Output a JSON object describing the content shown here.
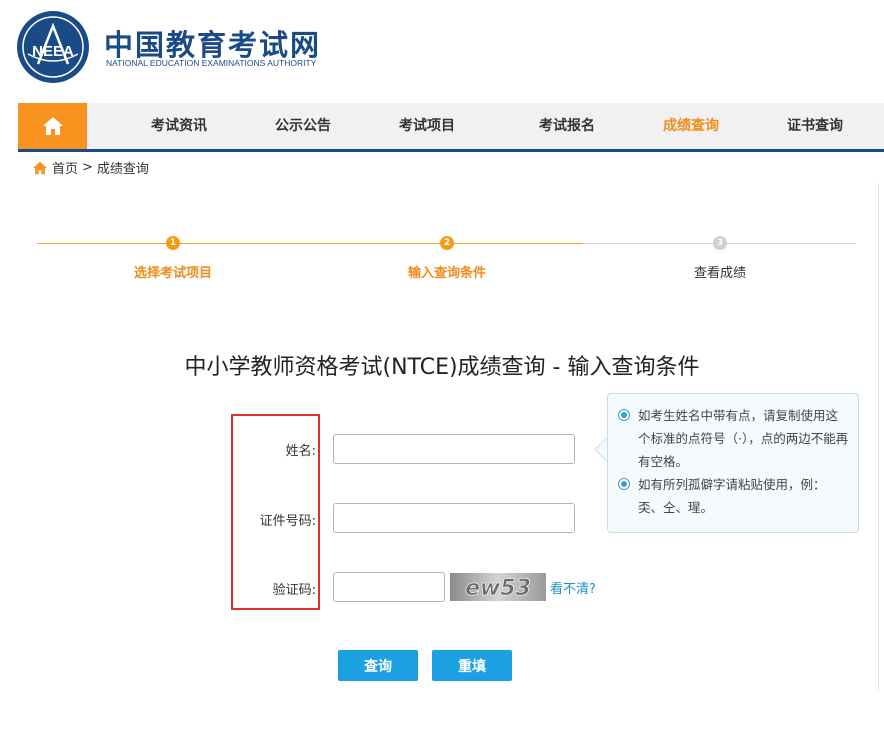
{
  "header": {
    "site_title": "中国教育考试网",
    "site_subtitle": "NATIONAL EDUCATION EXAMINATIONS AUTHORITY",
    "logo_text": "NEEA"
  },
  "nav": {
    "items": [
      "考试资讯",
      "公示公告",
      "考试项目",
      "考试报名",
      "成绩查询",
      "证书查询"
    ],
    "active": "成绩查询",
    "home_icon": "home-icon",
    "bg_color": "#f1f1f1",
    "home_color": "#f7931e",
    "accent_line_color": "#1b4b86"
  },
  "breadcrumb": {
    "home": "首页",
    "separator": ">",
    "current": "成绩查询"
  },
  "steps": [
    {
      "num": "1",
      "label": "选择考试项目",
      "state": "done"
    },
    {
      "num": "2",
      "label": "输入查询条件",
      "state": "active"
    },
    {
      "num": "3",
      "label": "查看成绩",
      "state": "pending"
    }
  ],
  "form": {
    "title": "中小学教师资格考试(NTCE)成绩查询 - 输入查询条件",
    "name_label": "姓名:",
    "name_value": "",
    "id_label": "证件号码:",
    "id_value": "",
    "captcha_label": "验证码:",
    "captcha_value": "",
    "captcha_text": "ew53",
    "refresh_label": "看不清?",
    "query_button": "查询",
    "reset_button": "重填"
  },
  "tips": [
    "如考生姓名中带有点，请复制使用这个标准的点符号（·），点的两边不能再有空格。",
    "如有所列孤僻字请粘贴使用，例：奀、仝、瑆。"
  ],
  "colors": {
    "orange": "#f08c1a",
    "blue_button": "#1ba1e2",
    "highlight_box": "#d9342b",
    "link": "#1e90c8"
  }
}
